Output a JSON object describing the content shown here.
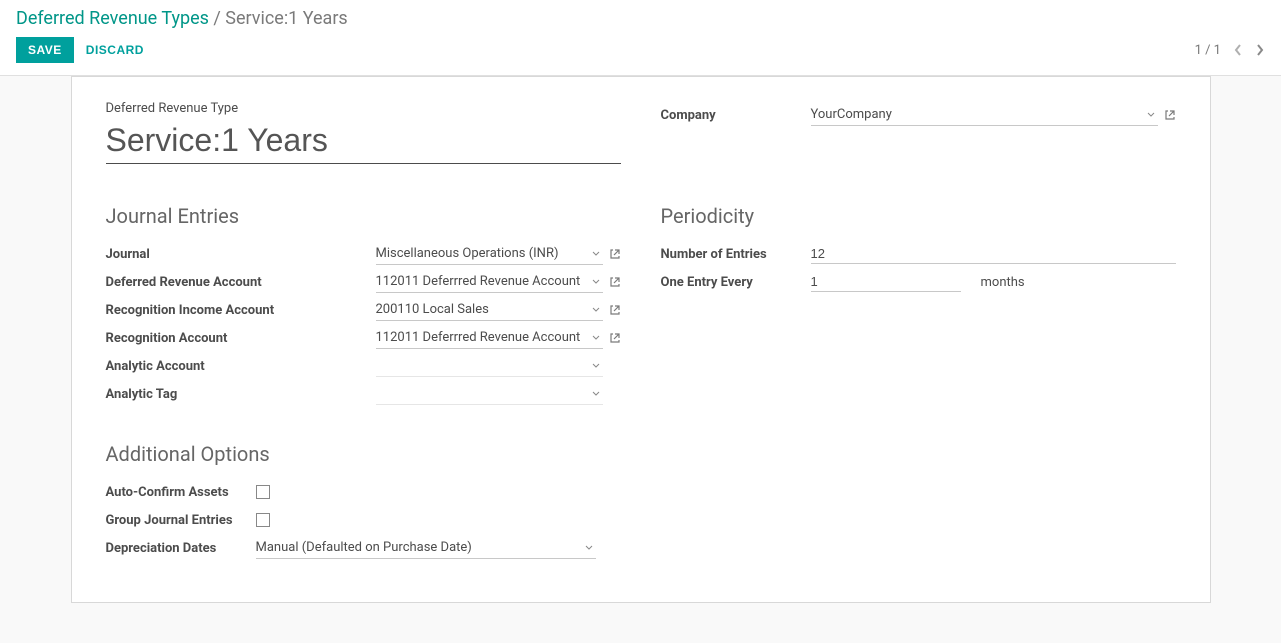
{
  "breadcrumb": {
    "parent": "Deferred Revenue Types",
    "sep": " / ",
    "current": "Service:1 Years"
  },
  "buttons": {
    "save": "Save",
    "discard": "Discard"
  },
  "pager": {
    "text": "1 / 1"
  },
  "form": {
    "type_label": "Deferred Revenue Type",
    "name": "Service:1 Years",
    "company_label": "Company",
    "company": "YourCompany"
  },
  "journal_section": {
    "title": "Journal Entries",
    "journal_label": "Journal",
    "journal": "Miscellaneous Operations (INR)",
    "def_rev_acct_label": "Deferred Revenue Account",
    "def_rev_acct": "112011 Deferrred Revenue Account",
    "recog_income_label": "Recognition Income Account",
    "recog_income": "200110 Local Sales",
    "recog_acct_label": "Recognition Account",
    "recog_acct": "112011 Deferrred Revenue Account",
    "analytic_acct_label": "Analytic Account",
    "analytic_acct": "",
    "analytic_tag_label": "Analytic Tag",
    "analytic_tag": ""
  },
  "periodicity_section": {
    "title": "Periodicity",
    "num_entries_label": "Number of Entries",
    "num_entries": "12",
    "one_every_label": "One Entry Every",
    "one_every": "1",
    "unit": "months"
  },
  "additional_section": {
    "title": "Additional Options",
    "auto_confirm_label": "Auto-Confirm Assets",
    "group_journal_label": "Group Journal Entries",
    "deprec_dates_label": "Depreciation Dates",
    "deprec_dates": "Manual (Defaulted on Purchase Date)"
  }
}
